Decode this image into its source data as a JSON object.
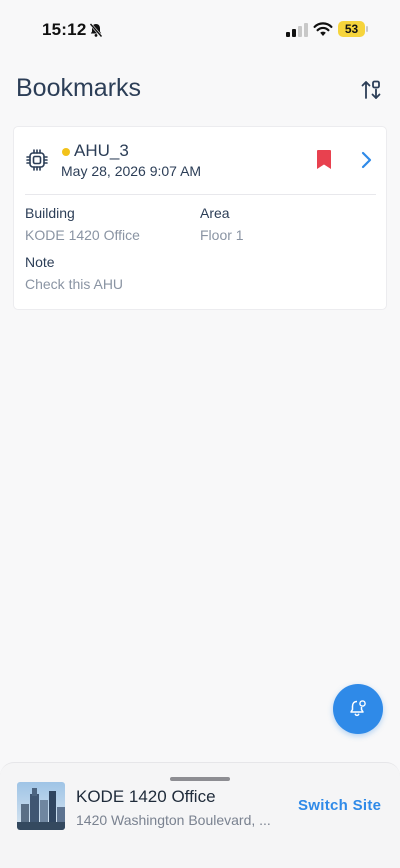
{
  "status_bar": {
    "time": "15:12",
    "battery_level": "53",
    "icons": [
      "bell-off-icon",
      "signal-icon",
      "wifi-icon",
      "battery-icon"
    ]
  },
  "header": {
    "title": "Bookmarks",
    "sort_icon": "sort-icon"
  },
  "bookmarks": [
    {
      "equipment_icon": "chip-icon",
      "status_color": "#f2c21a",
      "name": "AHU_3",
      "date": "May 28, 2026 9:07 AM",
      "bookmarked_color": "#e8414f",
      "fields": {
        "building_label": "Building",
        "building_value": "KODE 1420 Office",
        "area_label": "Area",
        "area_value": "Floor 1",
        "note_label": "Note",
        "note_value": "Check this AHU"
      }
    }
  ],
  "fab": {
    "icon": "bell-settings-icon",
    "color": "#2f8ae8"
  },
  "site_sheet": {
    "site_name": "KODE 1420 Office",
    "site_address": "1420 Washington Boulevard, ...",
    "switch_label": "Switch Site",
    "accent": "#2f8ae8"
  }
}
